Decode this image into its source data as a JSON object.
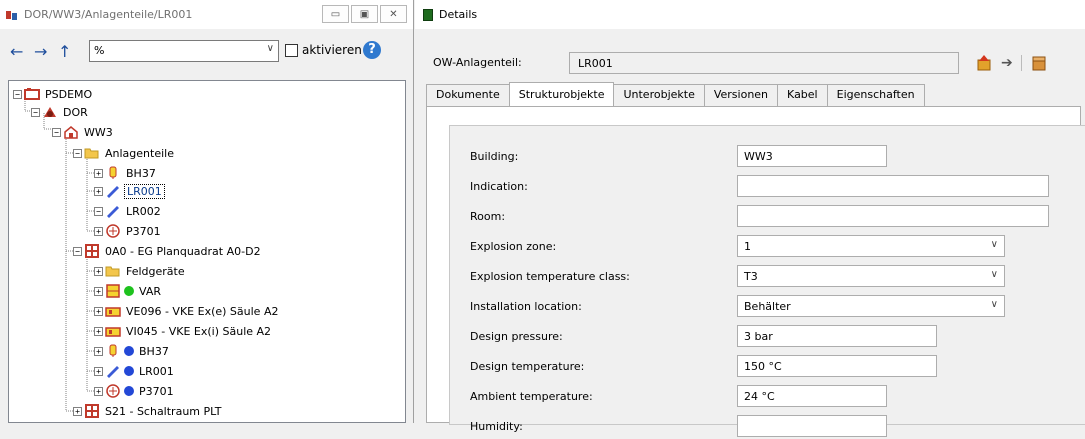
{
  "left_window": {
    "title": "DOR/WW3/Anlagenteile/LR001",
    "win_buttons": [
      "▭",
      "▣",
      "✕"
    ],
    "nav": {
      "back": "←",
      "forward": "→",
      "up": "↑",
      "filter_value": "%",
      "activate_label": "aktivieren",
      "help": "?"
    },
    "tree": [
      {
        "label": "PSDEMO",
        "icon": "project-icon",
        "exp": "−"
      },
      {
        "label": "DOR",
        "icon": "plant-icon",
        "exp": "−"
      },
      {
        "label": "WW3",
        "icon": "unit-icon",
        "exp": "−"
      },
      {
        "label": "Anlagenteile",
        "icon": "folder-icon",
        "exp": "−"
      },
      {
        "label": "BH37",
        "icon": "bh-icon",
        "exp": "+"
      },
      {
        "label": "LR001",
        "icon": "level-icon",
        "exp": "+",
        "selected": true
      },
      {
        "label": "LR002",
        "icon": "level-icon",
        "exp": "−"
      },
      {
        "label": "P3701",
        "icon": "pump-icon",
        "exp": "+"
      },
      {
        "label": "0A0 - EG Planquadrat A0-D2",
        "icon": "area-icon",
        "exp": "−"
      },
      {
        "label": "Feldgeräte",
        "icon": "folder-icon",
        "exp": "+"
      },
      {
        "label": "VAR",
        "icon": "var-icon",
        "exp": "+"
      },
      {
        "label": "VE096 - VKE Ex(e) Säule A2",
        "icon": "cabinet-icon",
        "exp": "+"
      },
      {
        "label": "VI045 - VKE Ex(i) Säule A2",
        "icon": "cabinet-icon",
        "exp": "+"
      },
      {
        "label": "BH37",
        "icon": "bh-icon",
        "exp": "+"
      },
      {
        "label": "LR001",
        "icon": "level-icon",
        "exp": "+"
      },
      {
        "label": "P3701",
        "icon": "pump-icon",
        "exp": "+"
      },
      {
        "label": "S21 - Schaltraum PLT",
        "icon": "area-icon",
        "exp": "+"
      }
    ]
  },
  "right_window": {
    "title": "Details",
    "ow_label": "OW-Anlagenteil:",
    "ow_value": "LR001",
    "tabs": [
      "Dokumente",
      "Strukturobjekte",
      "Unterobjekte",
      "Versionen",
      "Kabel",
      "Eigenschaften"
    ],
    "active_tab": 1,
    "fields": [
      {
        "label": "Building:",
        "value": "WW3",
        "kind": "text"
      },
      {
        "label": "Indication:",
        "value": "",
        "kind": "text"
      },
      {
        "label": "Room:",
        "value": "",
        "kind": "text"
      },
      {
        "label": "Explosion zone:",
        "value": "1",
        "kind": "select"
      },
      {
        "label": "Explosion temperature class:",
        "value": "T3",
        "kind": "select"
      },
      {
        "label": "Installation location:",
        "value": "Behälter",
        "kind": "select"
      },
      {
        "label": "Design pressure:",
        "value": "3 bar",
        "kind": "text"
      },
      {
        "label": "Design temperature:",
        "value": "150 °C",
        "kind": "text"
      },
      {
        "label": "Ambient temperature:",
        "value": "24 °C",
        "kind": "text"
      },
      {
        "label": "Humidity:",
        "value": "",
        "kind": "text"
      }
    ]
  }
}
